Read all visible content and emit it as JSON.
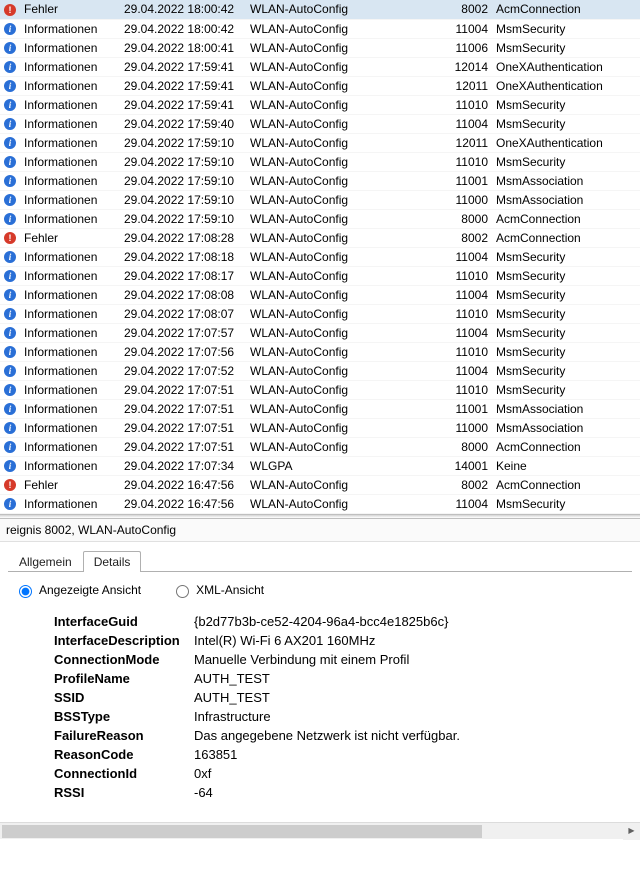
{
  "events": [
    {
      "level": "Fehler",
      "icon": "error",
      "date": "29.04.2022 18:00:42",
      "source": "WLAN-AutoConfig",
      "id": 8002,
      "cat": "AcmConnection",
      "selected": true
    },
    {
      "level": "Informationen",
      "icon": "info",
      "date": "29.04.2022 18:00:42",
      "source": "WLAN-AutoConfig",
      "id": 11004,
      "cat": "MsmSecurity"
    },
    {
      "level": "Informationen",
      "icon": "info",
      "date": "29.04.2022 18:00:41",
      "source": "WLAN-AutoConfig",
      "id": 11006,
      "cat": "MsmSecurity"
    },
    {
      "level": "Informationen",
      "icon": "info",
      "date": "29.04.2022 17:59:41",
      "source": "WLAN-AutoConfig",
      "id": 12014,
      "cat": "OneXAuthentication"
    },
    {
      "level": "Informationen",
      "icon": "info",
      "date": "29.04.2022 17:59:41",
      "source": "WLAN-AutoConfig",
      "id": 12011,
      "cat": "OneXAuthentication"
    },
    {
      "level": "Informationen",
      "icon": "info",
      "date": "29.04.2022 17:59:41",
      "source": "WLAN-AutoConfig",
      "id": 11010,
      "cat": "MsmSecurity"
    },
    {
      "level": "Informationen",
      "icon": "info",
      "date": "29.04.2022 17:59:40",
      "source": "WLAN-AutoConfig",
      "id": 11004,
      "cat": "MsmSecurity"
    },
    {
      "level": "Informationen",
      "icon": "info",
      "date": "29.04.2022 17:59:10",
      "source": "WLAN-AutoConfig",
      "id": 12011,
      "cat": "OneXAuthentication"
    },
    {
      "level": "Informationen",
      "icon": "info",
      "date": "29.04.2022 17:59:10",
      "source": "WLAN-AutoConfig",
      "id": 11010,
      "cat": "MsmSecurity"
    },
    {
      "level": "Informationen",
      "icon": "info",
      "date": "29.04.2022 17:59:10",
      "source": "WLAN-AutoConfig",
      "id": 11001,
      "cat": "MsmAssociation"
    },
    {
      "level": "Informationen",
      "icon": "info",
      "date": "29.04.2022 17:59:10",
      "source": "WLAN-AutoConfig",
      "id": 11000,
      "cat": "MsmAssociation"
    },
    {
      "level": "Informationen",
      "icon": "info",
      "date": "29.04.2022 17:59:10",
      "source": "WLAN-AutoConfig",
      "id": 8000,
      "cat": "AcmConnection"
    },
    {
      "level": "Fehler",
      "icon": "error",
      "date": "29.04.2022 17:08:28",
      "source": "WLAN-AutoConfig",
      "id": 8002,
      "cat": "AcmConnection"
    },
    {
      "level": "Informationen",
      "icon": "info",
      "date": "29.04.2022 17:08:18",
      "source": "WLAN-AutoConfig",
      "id": 11004,
      "cat": "MsmSecurity"
    },
    {
      "level": "Informationen",
      "icon": "info",
      "date": "29.04.2022 17:08:17",
      "source": "WLAN-AutoConfig",
      "id": 11010,
      "cat": "MsmSecurity"
    },
    {
      "level": "Informationen",
      "icon": "info",
      "date": "29.04.2022 17:08:08",
      "source": "WLAN-AutoConfig",
      "id": 11004,
      "cat": "MsmSecurity"
    },
    {
      "level": "Informationen",
      "icon": "info",
      "date": "29.04.2022 17:08:07",
      "source": "WLAN-AutoConfig",
      "id": 11010,
      "cat": "MsmSecurity"
    },
    {
      "level": "Informationen",
      "icon": "info",
      "date": "29.04.2022 17:07:57",
      "source": "WLAN-AutoConfig",
      "id": 11004,
      "cat": "MsmSecurity"
    },
    {
      "level": "Informationen",
      "icon": "info",
      "date": "29.04.2022 17:07:56",
      "source": "WLAN-AutoConfig",
      "id": 11010,
      "cat": "MsmSecurity"
    },
    {
      "level": "Informationen",
      "icon": "info",
      "date": "29.04.2022 17:07:52",
      "source": "WLAN-AutoConfig",
      "id": 11004,
      "cat": "MsmSecurity"
    },
    {
      "level": "Informationen",
      "icon": "info",
      "date": "29.04.2022 17:07:51",
      "source": "WLAN-AutoConfig",
      "id": 11010,
      "cat": "MsmSecurity"
    },
    {
      "level": "Informationen",
      "icon": "info",
      "date": "29.04.2022 17:07:51",
      "source": "WLAN-AutoConfig",
      "id": 11001,
      "cat": "MsmAssociation"
    },
    {
      "level": "Informationen",
      "icon": "info",
      "date": "29.04.2022 17:07:51",
      "source": "WLAN-AutoConfig",
      "id": 11000,
      "cat": "MsmAssociation"
    },
    {
      "level": "Informationen",
      "icon": "info",
      "date": "29.04.2022 17:07:51",
      "source": "WLAN-AutoConfig",
      "id": 8000,
      "cat": "AcmConnection"
    },
    {
      "level": "Informationen",
      "icon": "info",
      "date": "29.04.2022 17:07:34",
      "source": "WLGPA",
      "id": 14001,
      "cat": "Keine"
    },
    {
      "level": "Fehler",
      "icon": "error",
      "date": "29.04.2022 16:47:56",
      "source": "WLAN-AutoConfig",
      "id": 8002,
      "cat": "AcmConnection"
    },
    {
      "level": "Informationen",
      "icon": "info",
      "date": "29.04.2022 16:47:56",
      "source": "WLAN-AutoConfig",
      "id": 11004,
      "cat": "MsmSecurity"
    }
  ],
  "header": "reignis 8002, WLAN-AutoConfig",
  "tabs": {
    "allgemein": "Allgemein",
    "details": "Details"
  },
  "radio": {
    "angezeigte": "Angezeigte Ansicht",
    "xml": "XML-Ansicht"
  },
  "detail": {
    "InterfaceGuid": "{b2d77b3b-ce52-4204-96a4-bcc4e1825b6c}",
    "InterfaceDescription": "Intel(R) Wi-Fi 6 AX201 160MHz",
    "ConnectionMode": "Manuelle Verbindung mit einem Profil",
    "ProfileName": "AUTH_TEST",
    "SSID": "AUTH_TEST",
    "BSSType": "Infrastructure",
    "FailureReason": "Das angegebene Netzwerk ist nicht verfügbar.",
    "ReasonCode": "163851",
    "ConnectionId": "0xf",
    "RSSI": "-64"
  },
  "detailKeys": {
    "InterfaceGuid": "InterfaceGuid",
    "InterfaceDescription": "InterfaceDescription",
    "ConnectionMode": "ConnectionMode",
    "ProfileName": "ProfileName",
    "SSID": "SSID",
    "BSSType": "BSSType",
    "FailureReason": "FailureReason",
    "ReasonCode": "ReasonCode",
    "ConnectionId": "ConnectionId",
    "RSSI": "RSSI"
  }
}
